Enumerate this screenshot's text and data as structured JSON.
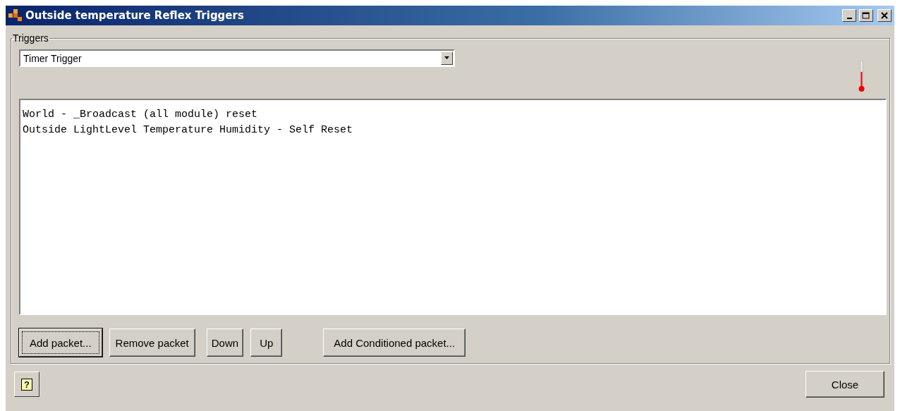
{
  "window": {
    "title": "Outside temperature Reflex Triggers"
  },
  "triggers": {
    "legend": "Triggers",
    "dropdown": {
      "value": "Timer Trigger"
    },
    "packets": [
      {
        "text": "World - _Broadcast (all module) reset"
      },
      {
        "text": "Outside LightLevel Temperature Humidity - Self Reset"
      }
    ],
    "buttons": [
      {
        "label": "Add packet...",
        "focused": true
      },
      {
        "label": "Remove packet",
        "focused": false
      },
      {
        "label": "Down",
        "focused": false
      },
      {
        "label": "Up",
        "focused": false
      },
      {
        "label": "Add Conditioned packet...",
        "focused": false
      }
    ]
  },
  "footer": {
    "help": "?",
    "close": "Close"
  }
}
